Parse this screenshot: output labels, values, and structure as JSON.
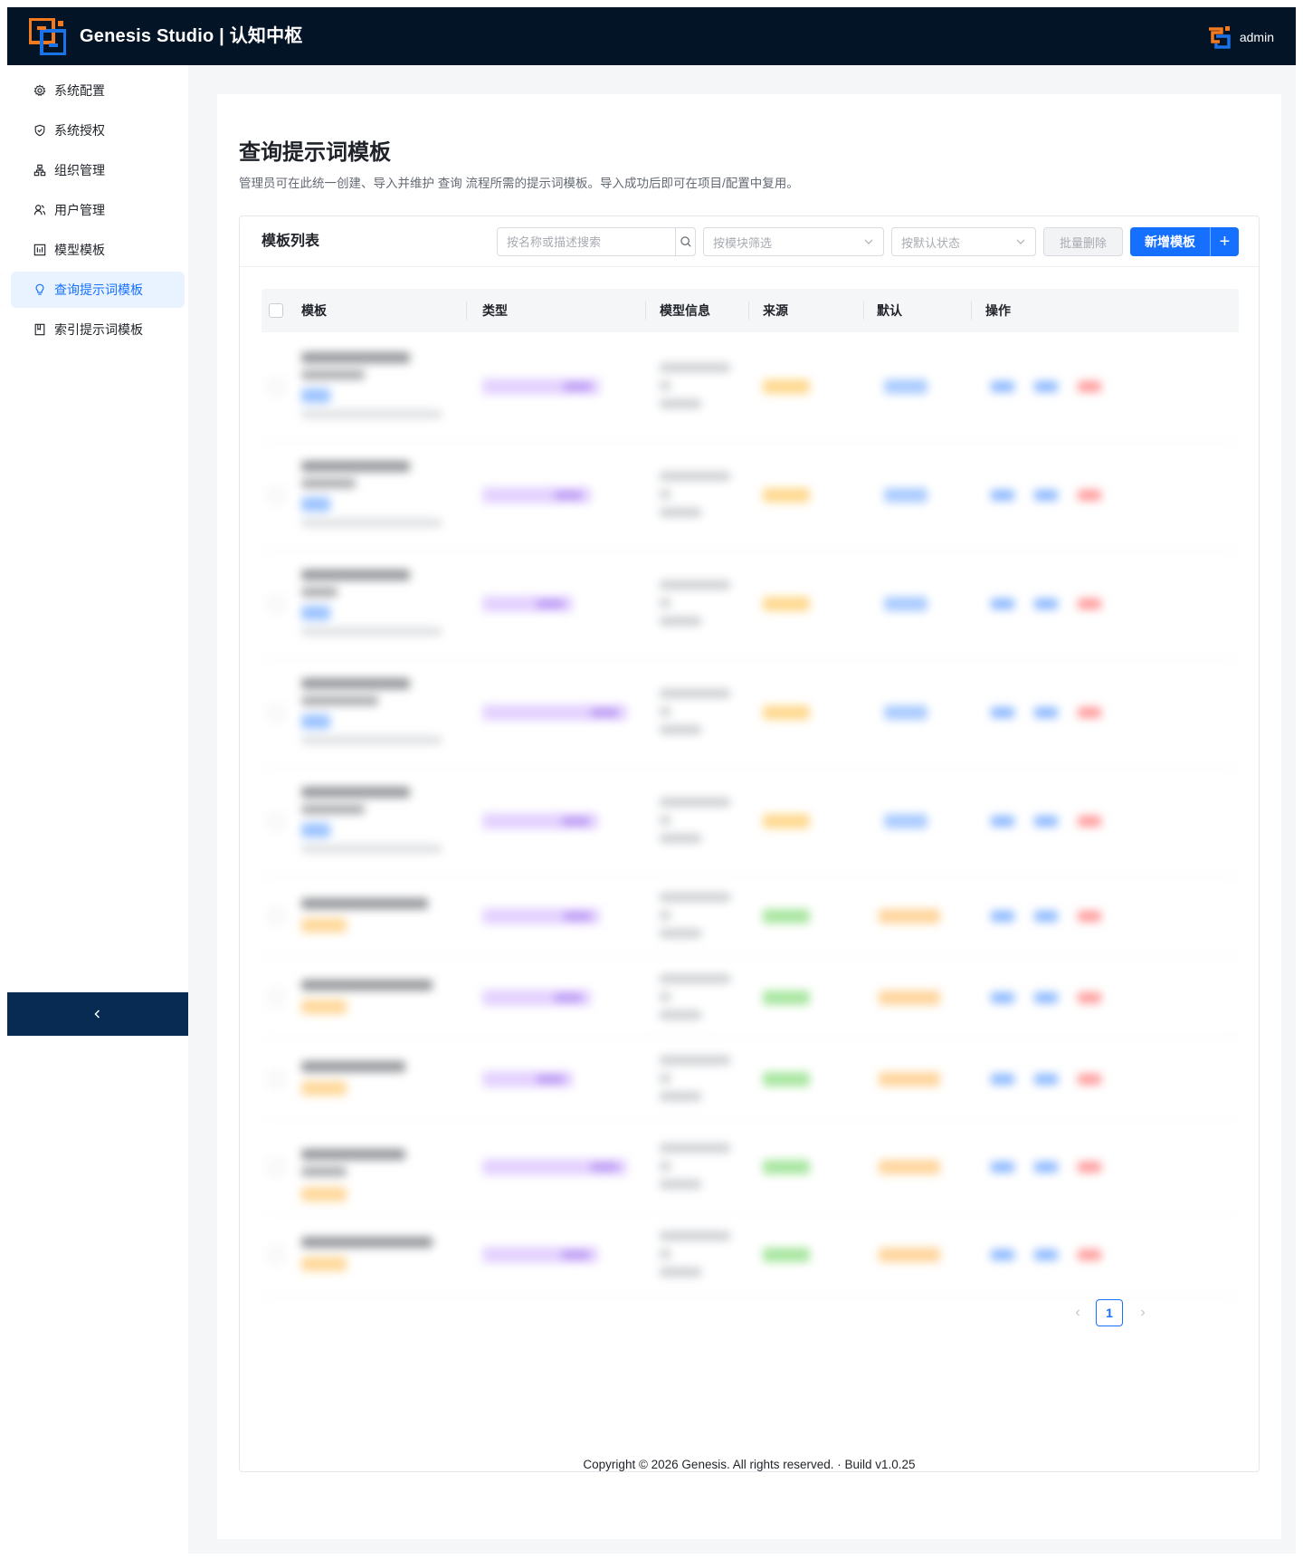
{
  "app": {
    "title": "Genesis Studio | 认知中枢",
    "user": "admin"
  },
  "sidebar": {
    "items": [
      {
        "label": "系统配置",
        "icon": "gear-icon",
        "active": false
      },
      {
        "label": "系统授权",
        "icon": "shield-icon",
        "active": false
      },
      {
        "label": "组织管理",
        "icon": "org-chart-icon",
        "active": false
      },
      {
        "label": "用户管理",
        "icon": "users-icon",
        "active": false
      },
      {
        "label": "模型模板",
        "icon": "model-board-icon",
        "active": false
      },
      {
        "label": "查询提示词模板",
        "icon": "lightbulb-icon",
        "active": true
      },
      {
        "label": "索引提示词模板",
        "icon": "book-icon",
        "active": false
      }
    ],
    "collapse_glyph": "‹"
  },
  "page": {
    "title": "查询提示词模板",
    "description": "管理员可在此统一创建、导入并维护 查询 流程所需的提示词模板。导入成功后即可在项目/配置中复用。"
  },
  "card": {
    "title": "模板列表",
    "search_placeholder": "按名称或描述搜索",
    "module_filter_placeholder": "按模块筛选",
    "default_filter_placeholder": "按默认状态",
    "batch_delete": "批量删除",
    "add_template": "新增模板",
    "add_plus": "+"
  },
  "table": {
    "columns": [
      "模板",
      "类型",
      "模型信息",
      "来源",
      "默认",
      "操作"
    ],
    "rows_note_blurred": true
  },
  "pagination": {
    "current": "1",
    "prev": "‹",
    "next": "›"
  },
  "footer": {
    "text": "Copyright © 2026 Genesis. All rights reserved. · Build v1.0.25"
  },
  "colors": {
    "topbar": "#031427",
    "accent": "#1670ff",
    "collapse_bar": "#072b52",
    "logo_orange": "#f47a1f",
    "logo_blue": "#1a73e8"
  }
}
